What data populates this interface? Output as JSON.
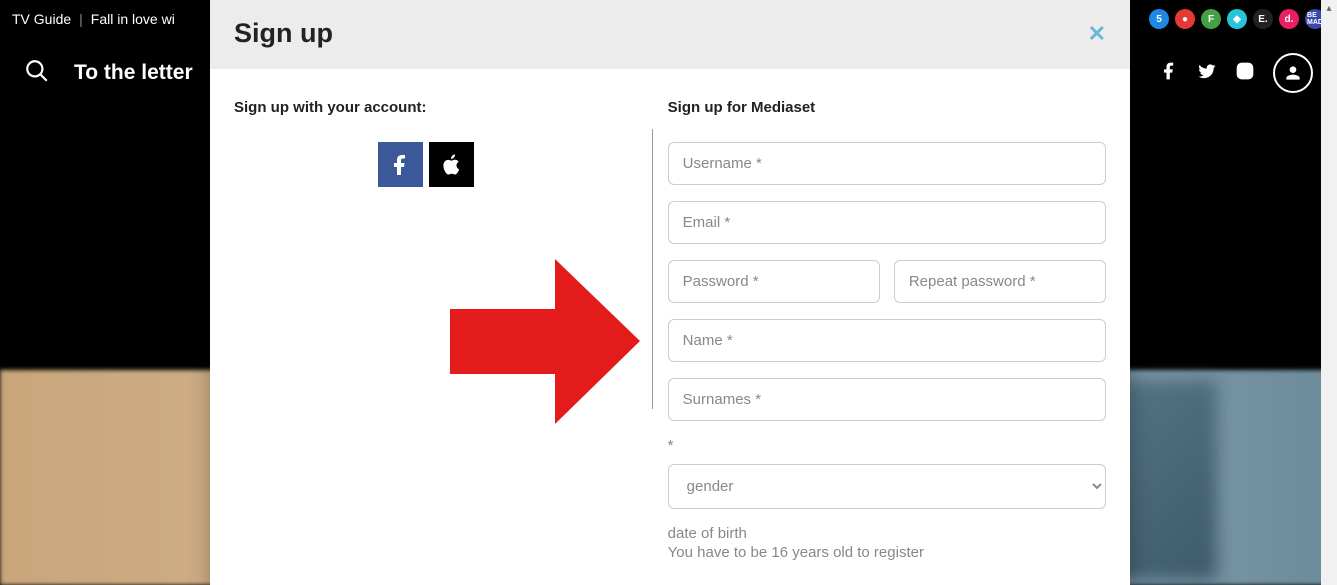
{
  "topbar": {
    "guide_label": "TV Guide",
    "promo_text": "Fall in love wi"
  },
  "nav": {
    "title": "To the letter"
  },
  "modal": {
    "title": "Sign up",
    "left_heading": "Sign up with your account:",
    "right_heading": "Sign up for Mediaset",
    "fields": {
      "username_placeholder": "Username *",
      "email_placeholder": "Email *",
      "password_placeholder": "Password *",
      "repeat_password_placeholder": "Repeat password *",
      "name_placeholder": "Name *",
      "surnames_placeholder": "Surnames *",
      "asterisk": "*",
      "gender_placeholder": "gender",
      "dob_label": "date of birth",
      "dob_hint": "You have to be 16 years old to register"
    }
  },
  "channels": [
    {
      "label": "5",
      "class": "ci-blue"
    },
    {
      "label": "●",
      "class": "ci-red"
    },
    {
      "label": "F",
      "class": "ci-green"
    },
    {
      "label": "◆",
      "class": "ci-teal"
    },
    {
      "label": "E.",
      "class": "ci-dark"
    },
    {
      "label": "d.",
      "class": "ci-pink"
    },
    {
      "label": "BE MAD",
      "class": "ci-navy"
    }
  ]
}
